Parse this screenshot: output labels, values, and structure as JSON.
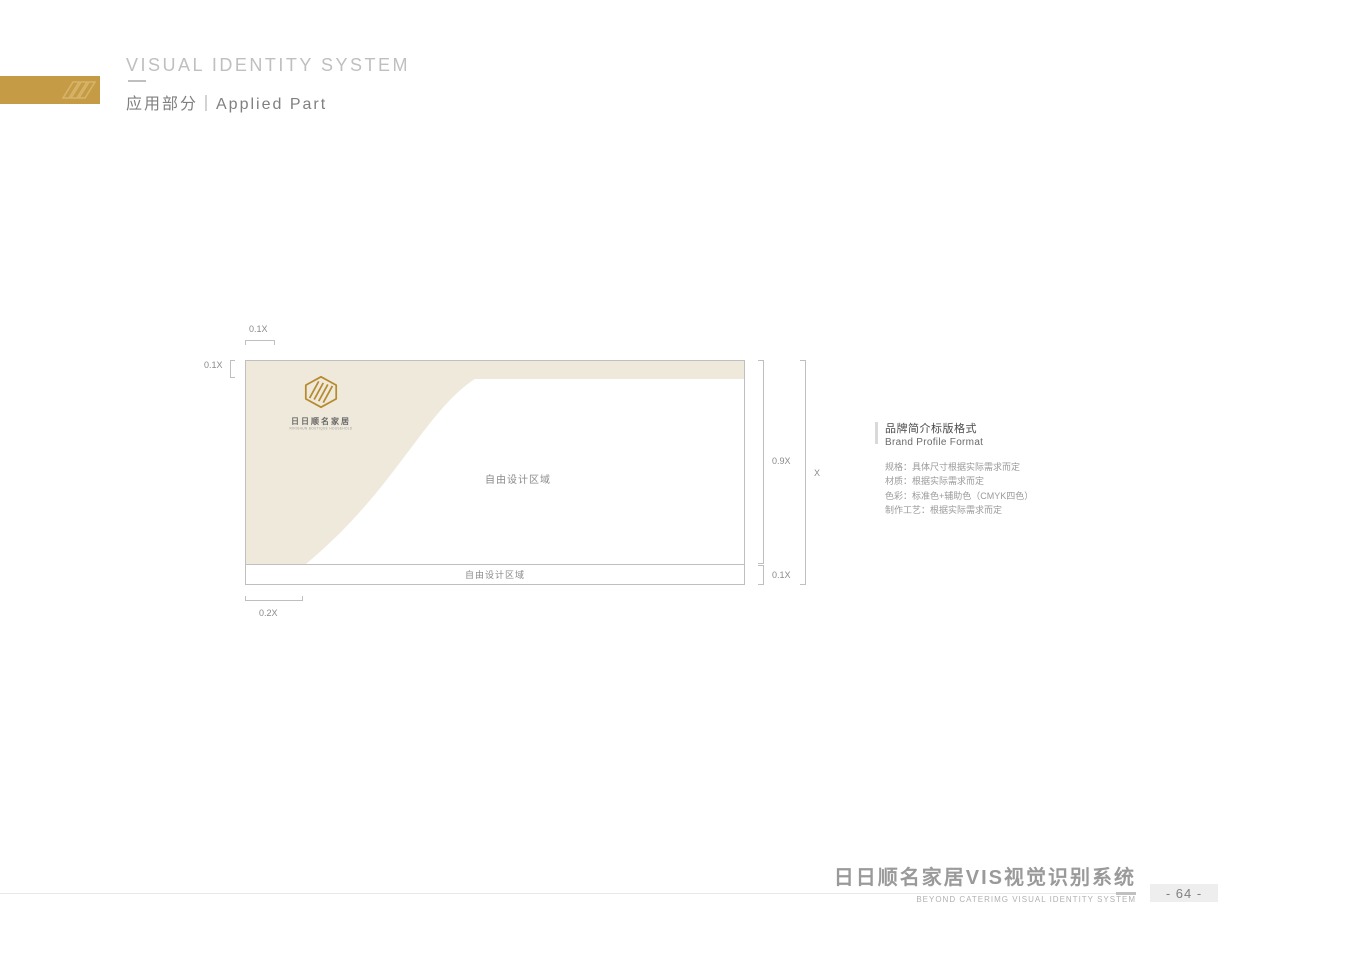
{
  "header": {
    "title": "VISUAL IDENTITY SYSTEM",
    "subtitle": "应用部分｜Applied Part"
  },
  "diagram": {
    "logo_brand_cn": "日日顺名家居",
    "logo_brand_en": "RIRISHUN BOUTIQUE HOUSEHOLD",
    "free_area_main": "自由设计区域",
    "free_area_bottom": "自由设计区域",
    "dims": {
      "top_left": "0.1X",
      "left_top": "0.1X",
      "right_main": "0.9X",
      "right_total": "X",
      "right_bottom": "0.1X",
      "bottom_left": "0.2X"
    }
  },
  "desc": {
    "title_cn": "品牌简介标版格式",
    "title_en": "Brand Profile Format",
    "spec": "规格：具体尺寸根据实际需求而定",
    "material": "材质：根据实际需求而定",
    "color": "色彩：标准色+辅助色（CMYK四色）",
    "craft": "制作工艺：根据实际需求而定"
  },
  "footer": {
    "brand_title": "日日顺名家居VIS视觉识别系统",
    "brand_sub": "BEYOND CATERIMG VISUAL IDENTITY SYSTEM",
    "page": "- 64 -"
  }
}
